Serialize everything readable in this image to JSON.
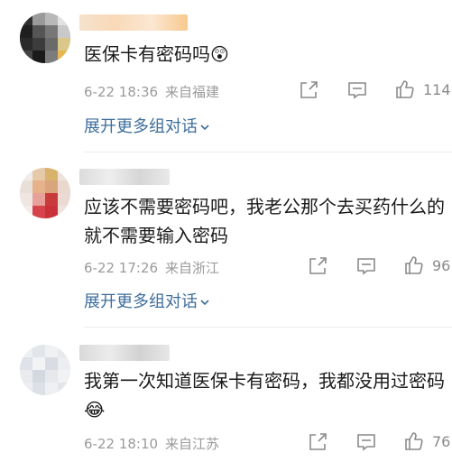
{
  "comments": [
    {
      "text": "医保卡有密码吗😲",
      "date": "6-22 18:36",
      "location": "来自福建",
      "likes": "114",
      "expand_label": "展开更多组对话"
    },
    {
      "text": "应该不需要密码吧，我老公那个去买药什么的就不需要输入密码",
      "date": "6-22 17:26",
      "location": "来自浙江",
      "likes": "96",
      "expand_label": "展开更多组对话"
    },
    {
      "text": "我第一次知道医保卡有密码，我都没用过密码😂",
      "date": "6-22 18:10",
      "location": "来自江苏",
      "likes": "76"
    }
  ],
  "icons": {
    "share": "share-icon",
    "comment": "comment-icon",
    "like": "thumbs-up-icon",
    "expand": "chevron-down-icon"
  },
  "colors": {
    "link": "#3e6d9c",
    "meta": "#9b9b9b",
    "text": "#1a1a1a"
  }
}
